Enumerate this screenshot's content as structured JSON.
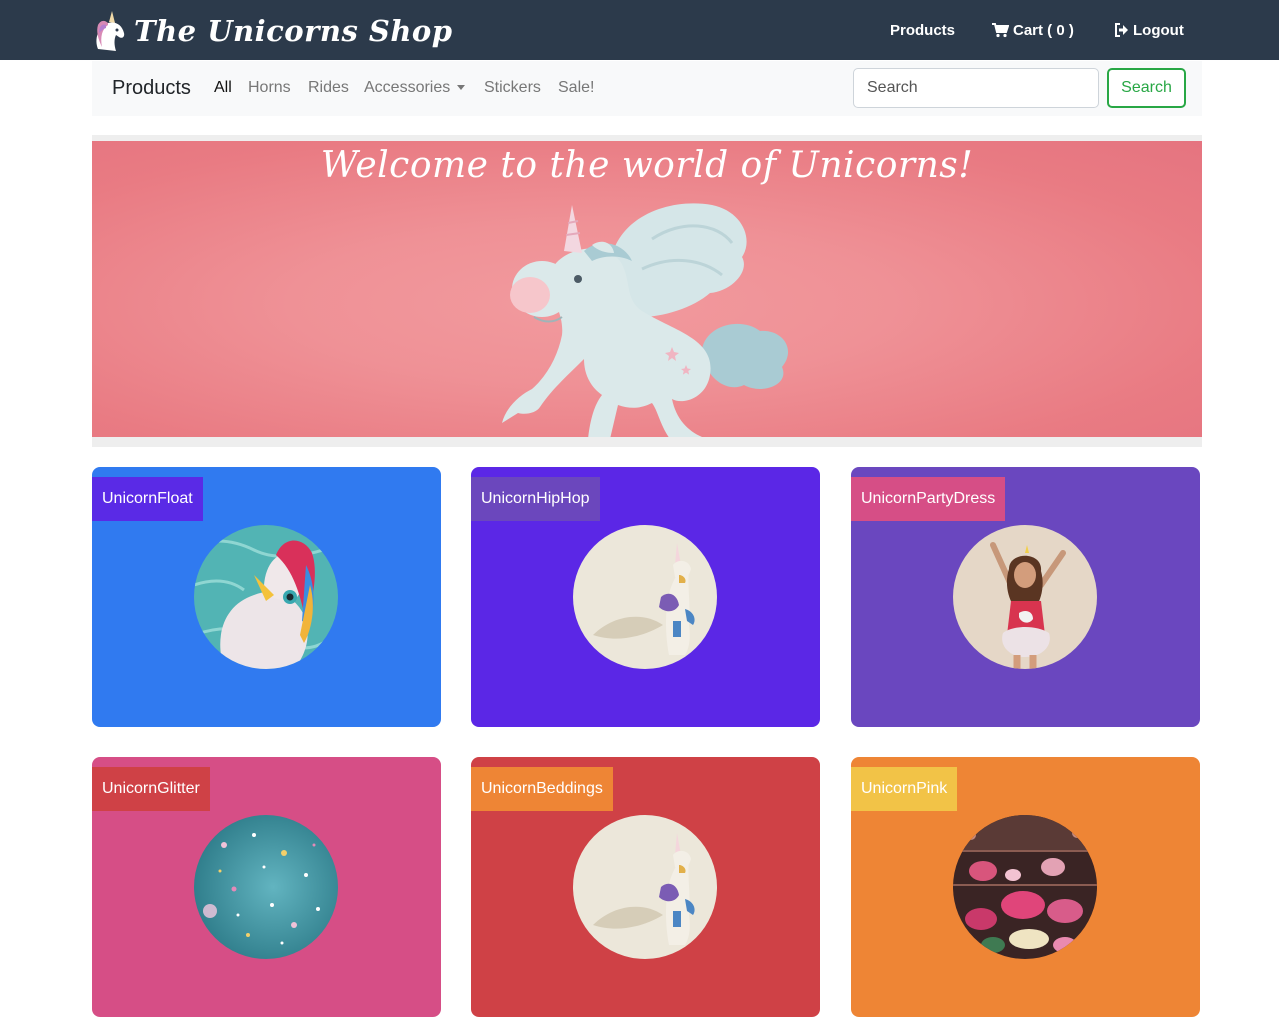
{
  "app": {
    "brand_name": "The Unicorns Shop",
    "logo_icon": "unicorn-head-icon"
  },
  "topnav": {
    "products_label": "Products",
    "cart_label": "Cart ( 0 )",
    "cart_icon": "cart-icon",
    "logout_label": "Logout",
    "logout_icon": "logout-icon"
  },
  "subnav": {
    "title": "Products",
    "links": [
      "All",
      "Horns",
      "Rides",
      "Accessories",
      "Stickers",
      "Sale!"
    ],
    "active_link": "All",
    "search_placeholder": "Search",
    "search_button": "Search"
  },
  "hero": {
    "title": "Welcome to the world of Unicorns!",
    "image_icon": "winged-unicorn-illustration"
  },
  "products": [
    {
      "name": "UnicornFloat",
      "card_color": "#307af0",
      "label_color": "#5a2ae6",
      "image": "unicorn-float-photo"
    },
    {
      "name": "UnicornHipHop",
      "card_color": "#5b27e6",
      "label_color": "#6b47bd",
      "image": "unicorn-figurine-photo"
    },
    {
      "name": "UnicornPartyDress",
      "card_color": "#6a47bf",
      "label_color": "#d64e86",
      "image": "girl-party-dress-photo"
    },
    {
      "name": "UnicornGlitter",
      "card_color": "#d64e86",
      "label_color": "#cf4146",
      "image": "glitter-confetti-photo"
    },
    {
      "name": "UnicornBeddings",
      "card_color": "#cf4146",
      "label_color": "#ee8535",
      "image": "unicorn-figurine-photo"
    },
    {
      "name": "UnicornPink",
      "card_color": "#ee8535",
      "label_color": "#f2c347",
      "image": "pink-unicorn-plush-photo"
    }
  ],
  "colors": {
    "topbar": "#2c3a4b",
    "subnav_bg": "#f8f9fa",
    "search_button": "#28a745",
    "hero_pink": "#ea818a"
  }
}
